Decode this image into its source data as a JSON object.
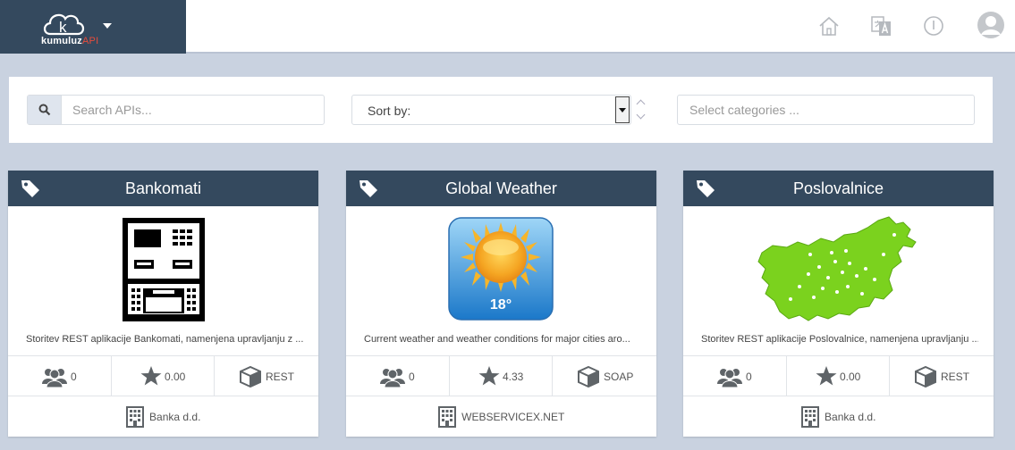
{
  "brand": {
    "logo_letter": "k",
    "name": "kumuluz",
    "suffix": "API"
  },
  "nav": [
    {
      "icon": "home-icon"
    },
    {
      "icon": "translate-icon"
    },
    {
      "icon": "info-icon"
    },
    {
      "icon": "user-avatar-icon"
    }
  ],
  "filters": {
    "search_placeholder": "Search APIs...",
    "sort_label": "Sort by:",
    "categories_placeholder": "Select categories ..."
  },
  "colors": {
    "header": "#34495e",
    "background": "#c9d2e0",
    "api_accent": "#e74c3c"
  },
  "cards": [
    {
      "title": "Bankomati",
      "image": "atm-machine",
      "description": "Storitev REST aplikacije Bankomati, namenjena upravljanju z ...",
      "subscribers": "0",
      "rating": "0.00",
      "type": "REST",
      "owner": "Banka d.d."
    },
    {
      "title": "Global Weather",
      "image": "weather-sun",
      "image_text": "18°",
      "description": "Current weather and weather conditions for major cities aro...",
      "subscribers": "0",
      "rating": "4.33",
      "type": "SOAP",
      "owner": "WEBSERVICEX.NET"
    },
    {
      "title": "Poslovalnice",
      "image": "slovenia-map",
      "description": "Storitev REST aplikacije Poslovalnice, namenjena upravljanju ...",
      "subscribers": "0",
      "rating": "0.00",
      "type": "REST",
      "owner": "Banka d.d."
    }
  ]
}
